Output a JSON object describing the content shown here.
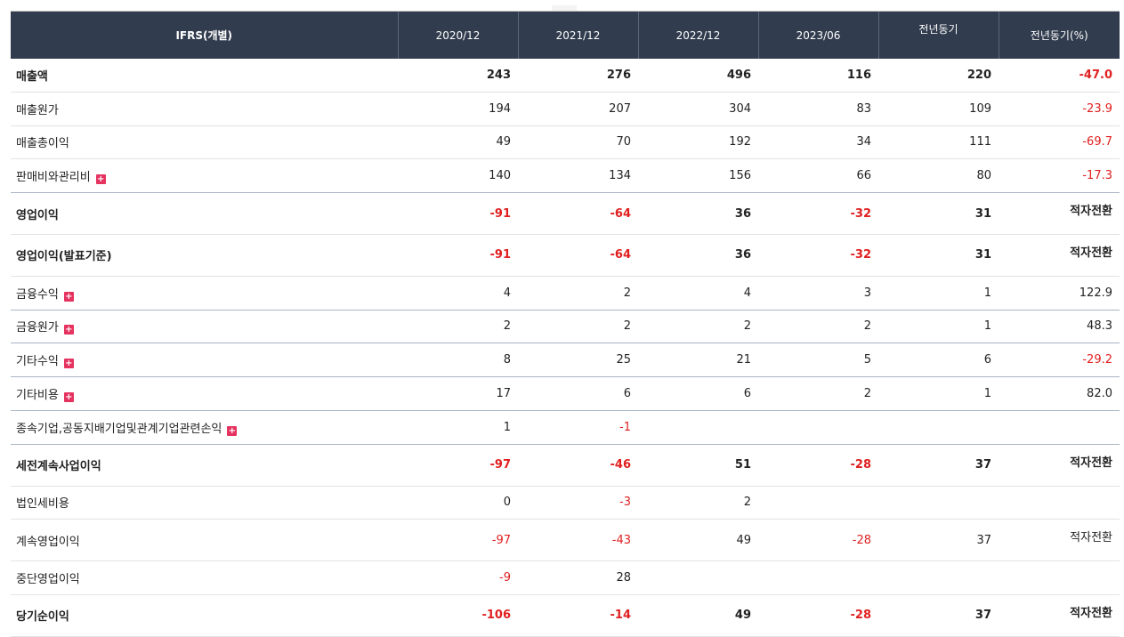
{
  "header": [
    "IFRS(개별)",
    "2020/12",
    "2021/12",
    "2022/12",
    "2023/06",
    "전년동기",
    "전년동기(%)"
  ],
  "rows": [
    {
      "label": "매출액",
      "bold": true,
      "expand": false,
      "sep": false,
      "values": [
        "243",
        "276",
        "496",
        "116",
        "220",
        "-47.0"
      ]
    },
    {
      "label": "매출원가",
      "bold": false,
      "expand": false,
      "sep": false,
      "values": [
        "194",
        "207",
        "304",
        "83",
        "109",
        "-23.9"
      ]
    },
    {
      "label": "매출총이익",
      "bold": false,
      "expand": false,
      "sep": false,
      "values": [
        "49",
        "70",
        "192",
        "34",
        "111",
        "-69.7"
      ]
    },
    {
      "label": "판매비와관리비",
      "bold": false,
      "expand": true,
      "sep": true,
      "values": [
        "140",
        "134",
        "156",
        "66",
        "80",
        "-17.3"
      ]
    },
    {
      "label": "영업이익",
      "bold": true,
      "expand": false,
      "sep": false,
      "values": [
        "-91",
        "-64",
        "36",
        "-32",
        "31",
        "적자전환"
      ]
    },
    {
      "label": "영업이익(발표기준)",
      "bold": true,
      "expand": false,
      "sep": false,
      "values": [
        "-91",
        "-64",
        "36",
        "-32",
        "31",
        "적자전환"
      ]
    },
    {
      "label": "금융수익",
      "bold": false,
      "expand": true,
      "sep": true,
      "values": [
        "4",
        "2",
        "4",
        "3",
        "1",
        "122.9"
      ]
    },
    {
      "label": "금융원가",
      "bold": false,
      "expand": true,
      "sep": true,
      "values": [
        "2",
        "2",
        "2",
        "2",
        "1",
        "48.3"
      ]
    },
    {
      "label": "기타수익",
      "bold": false,
      "expand": true,
      "sep": true,
      "values": [
        "8",
        "25",
        "21",
        "5",
        "6",
        "-29.2"
      ]
    },
    {
      "label": "기타비용",
      "bold": false,
      "expand": true,
      "sep": true,
      "values": [
        "17",
        "6",
        "6",
        "2",
        "1",
        "82.0"
      ]
    },
    {
      "label": "종속기업,공동지배기업및관계기업관련손익",
      "bold": false,
      "expand": true,
      "sep": true,
      "values": [
        "1",
        "-1",
        "",
        "",
        "",
        ""
      ]
    },
    {
      "label": "세전계속사업이익",
      "bold": true,
      "expand": false,
      "sep": false,
      "values": [
        "-97",
        "-46",
        "51",
        "-28",
        "37",
        "적자전환"
      ]
    },
    {
      "label": "법인세비용",
      "bold": false,
      "expand": false,
      "sep": false,
      "values": [
        "0",
        "-3",
        "2",
        "",
        "",
        ""
      ]
    },
    {
      "label": "계속영업이익",
      "bold": false,
      "expand": false,
      "sep": false,
      "values": [
        "-97",
        "-43",
        "49",
        "-28",
        "37",
        "적자전환"
      ]
    },
    {
      "label": "중단영업이익",
      "bold": false,
      "expand": false,
      "sep": false,
      "values": [
        "-9",
        "28",
        "",
        "",
        "",
        ""
      ]
    },
    {
      "label": "당기순이익",
      "bold": true,
      "expand": false,
      "sep": false,
      "values": [
        "-106",
        "-14",
        "49",
        "-28",
        "37",
        "적자전환"
      ]
    }
  ],
  "colors": {
    "header_bg": "#313c4e",
    "negative": "#e02020",
    "expand_icon": "#e5325f"
  },
  "expand_icon_glyph": "+"
}
